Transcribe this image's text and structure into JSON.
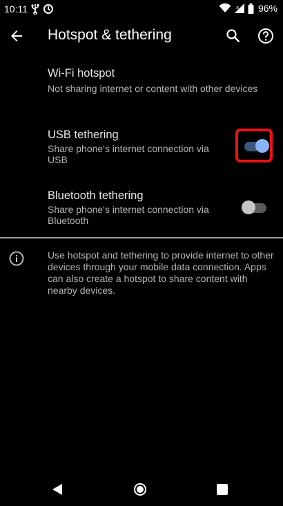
{
  "status_bar": {
    "time": "10:11",
    "battery": "96%",
    "icons": [
      "usb-icon",
      "sync-icon",
      "wifi-icon",
      "signal-icon",
      "battery-icon"
    ]
  },
  "app_bar": {
    "title": "Hotspot & tethering",
    "icons": [
      "back-arrow-icon",
      "search-icon",
      "help-icon"
    ]
  },
  "settings": [
    {
      "title": "Wi-Fi hotspot",
      "summary": "Not sharing internet or content with other devices"
    },
    {
      "title": "USB tethering",
      "summary_line1": "Share phone's internet connection via",
      "summary_line2": "USB",
      "toggle_on": true
    },
    {
      "title": "Bluetooth tethering",
      "summary_line1": "Share phone's internet connection via",
      "summary_line2": "Bluetooth",
      "toggle_on": false
    }
  ],
  "info": {
    "text": "Use hotspot and tethering to provide internet to other devices through your mobile data connection. Apps can also create a hotspot to share content with nearby devices."
  },
  "colors": {
    "accent": "#8ab4f8",
    "toggle_on_track": "#3b5680",
    "toggle_off_track": "#5a5a5a",
    "toggle_off_thumb": "#c6c6c6",
    "highlight": "#ee1111",
    "background": "#000000"
  },
  "nav_bar": {
    "icons": [
      "nav-back-icon",
      "nav-home-icon",
      "nav-recents-icon"
    ]
  }
}
